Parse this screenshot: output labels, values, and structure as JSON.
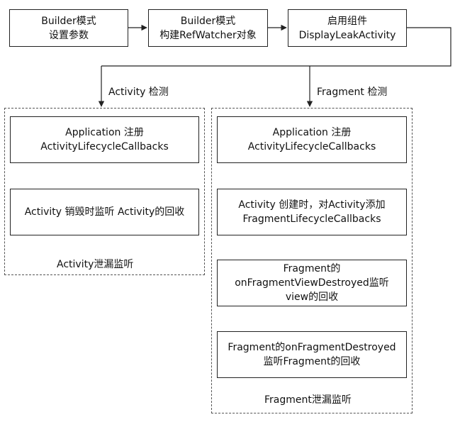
{
  "top": {
    "builder_params": [
      "Builder模式",
      "设置参数"
    ],
    "builder_watcher": [
      "Builder模式",
      "构建RefWatcher对象"
    ],
    "enable_component": [
      "启用组件",
      "DisplayLeakActivity"
    ]
  },
  "branch_labels": {
    "activity": "Activity 检测",
    "fragment": "Fragment 检测"
  },
  "activity_group": {
    "box1": [
      "Application 注册",
      "ActivityLifecycleCallbacks"
    ],
    "box2": [
      "Activity 销毁时监听 Activity的回收"
    ],
    "caption": "Activity泄漏监听"
  },
  "fragment_group": {
    "box1": [
      "Application 注册",
      "ActivityLifecycleCallbacks"
    ],
    "box2": [
      "Activity 创建时，对Activity添加",
      "FragmentLifecycleCallbacks"
    ],
    "box3": [
      "Fragment的",
      "onFragmentViewDestroyed监听",
      "view的回收"
    ],
    "box4": [
      "Fragment的onFragmentDestroyed",
      "监听Fragment的回收"
    ],
    "caption": "Fragment泄漏监听"
  },
  "colors": {
    "line": "#222222",
    "dashed_border": "#555555",
    "background": "#ffffff"
  }
}
